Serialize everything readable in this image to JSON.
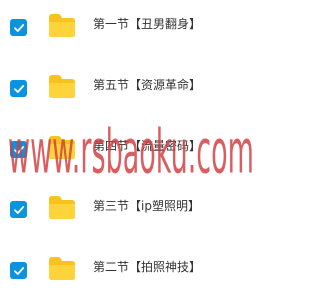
{
  "files": [
    {
      "name": "第一节【丑男翻身】",
      "checked": true
    },
    {
      "name": "第五节【资源革命】",
      "checked": true
    },
    {
      "name": "第四节【流量密码】",
      "checked": true
    },
    {
      "name": "第三节【ip塑照明】",
      "checked": true
    },
    {
      "name": "第二节【拍照神技】",
      "checked": true
    }
  ],
  "watermark": {
    "text": "www.rsbaoku.com"
  },
  "colors": {
    "checkbox": "#0a94e0",
    "folder": "#f9c21d",
    "watermark": "#d23a3e"
  },
  "icons": {
    "checkbox": "checkbox-checked-icon",
    "folder": "folder-icon"
  }
}
